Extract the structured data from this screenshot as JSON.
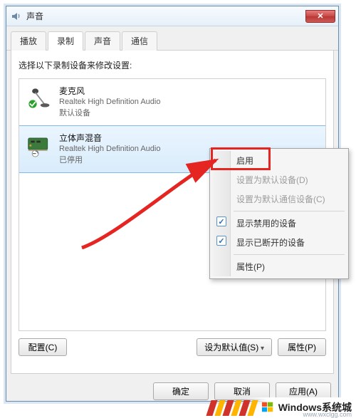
{
  "window": {
    "title": "声音"
  },
  "tabs": [
    "播放",
    "录制",
    "声音",
    "通信"
  ],
  "active_tab_index": 1,
  "instruction": "选择以下录制设备来修改设置:",
  "devices": [
    {
      "name": "麦克风",
      "driver": "Realtek High Definition Audio",
      "status": "默认设备",
      "selected": false
    },
    {
      "name": "立体声混音",
      "driver": "Realtek High Definition Audio",
      "status": "已停用",
      "selected": true
    }
  ],
  "pane_buttons": {
    "configure": "配置(C)",
    "set_default": "设为默认值(S)",
    "properties": "属性(P)"
  },
  "dialog_buttons": {
    "ok": "确定",
    "cancel": "取消",
    "apply": "应用(A)"
  },
  "context_menu": {
    "enable": "启用",
    "set_default_device": "设置为默认设备(D)",
    "set_default_comm": "设置为默认通信设备(C)",
    "show_disabled": "显示禁用的设备",
    "show_disconnected": "显示已断开的设备",
    "properties": "属性(P)"
  },
  "watermark": {
    "text": "Windows系统城",
    "url": "www.wxclgg.com"
  }
}
